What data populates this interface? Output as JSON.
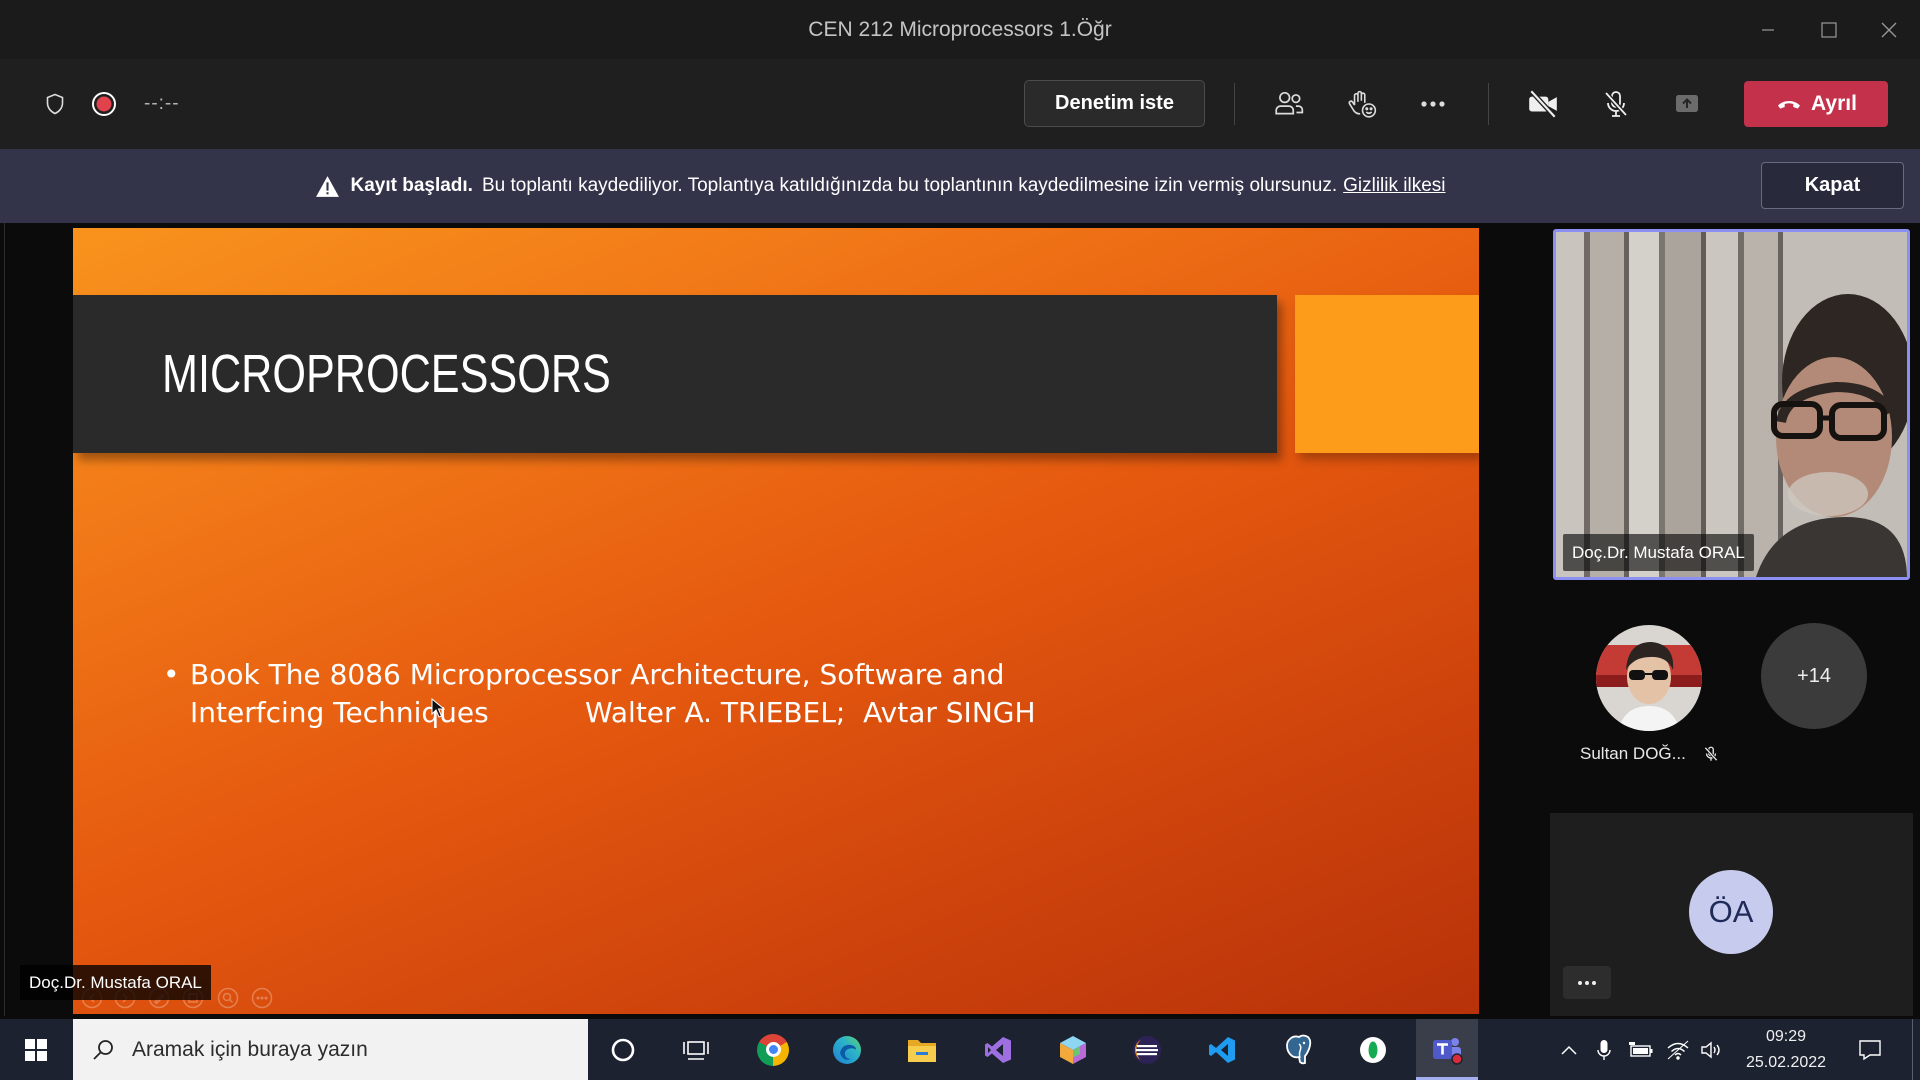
{
  "window": {
    "title": "CEN 212 Microprocessors 1.Öğr",
    "controls": [
      "minimize-icon",
      "maximize-icon",
      "close-icon"
    ]
  },
  "toolbar": {
    "timer": "--:--",
    "request_control_label": "Denetim iste",
    "leave_label": "Ayrıl",
    "recording": true,
    "camera_on": false,
    "mic_on": false,
    "icons": [
      "shield-icon",
      "record-icon",
      "participants-icon",
      "reactions-icon",
      "more-icon",
      "camera-off-icon",
      "mic-off-icon",
      "share-icon",
      "phone-hangup-icon"
    ]
  },
  "banner": {
    "title": "Kayıt başladı.",
    "message": "Bu toplantı kaydediliyor. Toplantıya katıldığınızda bu toplantının kaydedilmesine izin vermiş olursunuz.",
    "link": "Gizlilik ilkesi",
    "close_label": "Kapat",
    "icon": "warning-icon"
  },
  "slide": {
    "title": "MICROPROCESSORS",
    "bullet": {
      "line1": "Book The 8086 Microprocessor Architecture, Software and",
      "line2_title": "Interfcing Techniques",
      "line2_authors": "Walter A. TRIEBEL;  Avtar SINGH"
    },
    "controls": [
      "prev-slide-icon",
      "next-slide-icon",
      "pen-icon",
      "slides-grid-icon",
      "zoom-icon",
      "more-icon"
    ]
  },
  "stage": {
    "presenter_label": "Doç.Dr. Mustafa ORAL"
  },
  "participants": {
    "spotlight": {
      "name": "Doç.Dr. Mustafa ORAL",
      "video_on": true
    },
    "gallery": [
      {
        "name": "Sultan DOĞ...",
        "muted": true
      }
    ],
    "overflow": "+14",
    "audio_only": {
      "initials": "ÖA"
    }
  },
  "taskbar": {
    "search_placeholder": "Aramak için buraya yazın",
    "apps": [
      "cortana-icon",
      "task-view-icon",
      "chrome-icon",
      "edge-icon",
      "file-explorer-icon",
      "visual-studio-icon",
      "cube-app-icon",
      "eclipse-icon",
      "vscode-icon",
      "postgresql-icon",
      "green-app-icon",
      "teams-icon"
    ],
    "active_app": "teams-icon",
    "tray_icons": [
      "chevron-up-icon",
      "microphone-icon",
      "battery-icon",
      "wifi-icon",
      "volume-icon",
      "notification-icon"
    ],
    "clock": {
      "time": "09:29",
      "date": "25.02.2022"
    }
  },
  "colors": {
    "leave_button": "#c4314b",
    "banner_bg": "#33344a",
    "spotlight_border": "#8b90f2",
    "slide_orange": "#f8931d",
    "slide_accent": "#fd9b1a",
    "slide_title_bar": "#2a2a2a",
    "record_red": "#e2424c"
  }
}
